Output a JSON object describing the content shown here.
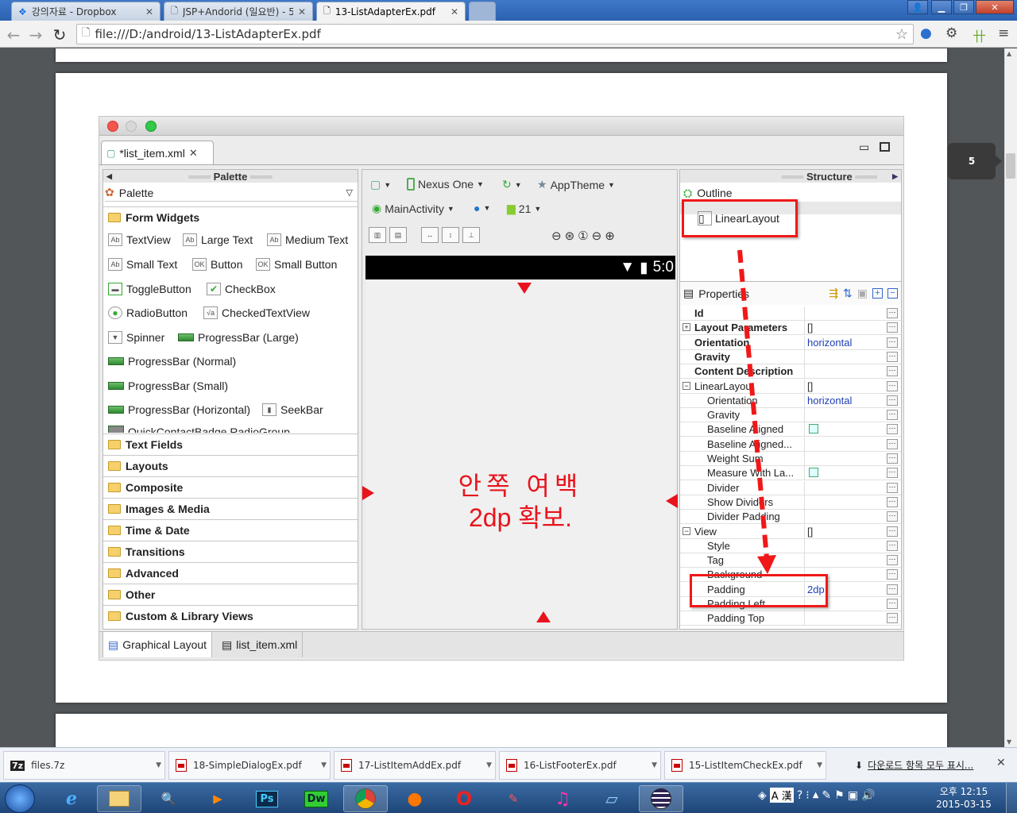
{
  "browser": {
    "tabs": [
      {
        "label": "강의자료 - Dropbox"
      },
      {
        "label": "JSP+Andorid (일요반) - 5"
      },
      {
        "label": "13-ListAdapterEx.pdf"
      }
    ],
    "url": "file:///D:/android/13-ListAdapterEx.pdf",
    "page_number": "5"
  },
  "eclipse": {
    "file_tab": "*list_item.xml",
    "palette": {
      "title": "Palette",
      "subtitle": "Palette",
      "group": "Form Widgets",
      "widgets": {
        "textview": "TextView",
        "large_text": "Large Text",
        "medium_text": "Medium Text",
        "small_text": "Small Text",
        "button": "Button",
        "small_button": "Small Button",
        "toggle": "ToggleButton",
        "checkbox": "CheckBox",
        "radio": "RadioButton",
        "checkedtv": "CheckedTextView",
        "spinner": "Spinner",
        "pb_large": "ProgressBar (Large)",
        "pb_normal": "ProgressBar (Normal)",
        "pb_small": "ProgressBar (Small)",
        "pb_horizontal": "ProgressBar (Horizontal)",
        "seekbar": "SeekBar",
        "cut": "QuickContactBadge   RadioGroup"
      },
      "categories": [
        "Text Fields",
        "Layouts",
        "Composite",
        "Images & Media",
        "Time & Date",
        "Transitions",
        "Advanced",
        "Other",
        "Custom & Library Views"
      ]
    },
    "canvas": {
      "device": "Nexus One",
      "theme": "AppTheme",
      "activity": "MainActivity",
      "api": "21",
      "clock": "5:0",
      "annotation_line1": "안쪽 여백",
      "annotation_line2": "2dp 확보."
    },
    "structure": {
      "title": "Structure",
      "outline": "Outline",
      "root": "LinearLayout",
      "properties_title": "Properties",
      "rows": [
        {
          "k": "Id",
          "v": "",
          "bold": true
        },
        {
          "k": "Layout Parameters",
          "v": "[]",
          "bold": true,
          "exp": "+"
        },
        {
          "k": "Orientation",
          "v": "horizontal",
          "bold": true
        },
        {
          "k": "Gravity",
          "v": "",
          "bold": true
        },
        {
          "k": "Content Description",
          "v": "",
          "bold": true
        },
        {
          "k": "LinearLayout",
          "v": "[]",
          "exp": "−",
          "indent": 0
        },
        {
          "k": "Orientation",
          "v": "horizontal",
          "indent": 1
        },
        {
          "k": "Gravity",
          "v": "",
          "indent": 1
        },
        {
          "k": "Baseline Aligned",
          "v": "",
          "indent": 1,
          "cb": true
        },
        {
          "k": "Baseline Aligned...",
          "v": "",
          "indent": 1
        },
        {
          "k": "Weight Sum",
          "v": "",
          "indent": 1
        },
        {
          "k": "Measure With La...",
          "v": "",
          "indent": 1,
          "cb": true
        },
        {
          "k": "Divider",
          "v": "",
          "indent": 1
        },
        {
          "k": "Show Dividers",
          "v": "",
          "indent": 1
        },
        {
          "k": "Divider Padding",
          "v": "",
          "indent": 1
        },
        {
          "k": "View",
          "v": "[]",
          "exp": "−",
          "indent": 0
        },
        {
          "k": "Style",
          "v": "",
          "indent": 1
        },
        {
          "k": "Tag",
          "v": "",
          "indent": 1
        },
        {
          "k": "Background",
          "v": "",
          "indent": 1
        },
        {
          "k": "Padding",
          "v": "2dp",
          "indent": 1
        },
        {
          "k": "Padding Left",
          "v": "",
          "indent": 1
        },
        {
          "k": "Padding Top",
          "v": "",
          "indent": 1
        }
      ]
    },
    "bottom_tabs": [
      "Graphical Layout",
      "list_item.xml"
    ]
  },
  "downloads": {
    "items": [
      "files.7z",
      "18-SimpleDialogEx.pdf",
      "17-ListItemAddEx.pdf",
      "16-ListFooterEx.pdf",
      "15-ListItemCheckEx.pdf"
    ],
    "show_all": "다운로드 항목 모두 표시..."
  },
  "taskbar": {
    "ime": "A 漢",
    "time": "오후 12:15",
    "date": "2015-03-15"
  }
}
